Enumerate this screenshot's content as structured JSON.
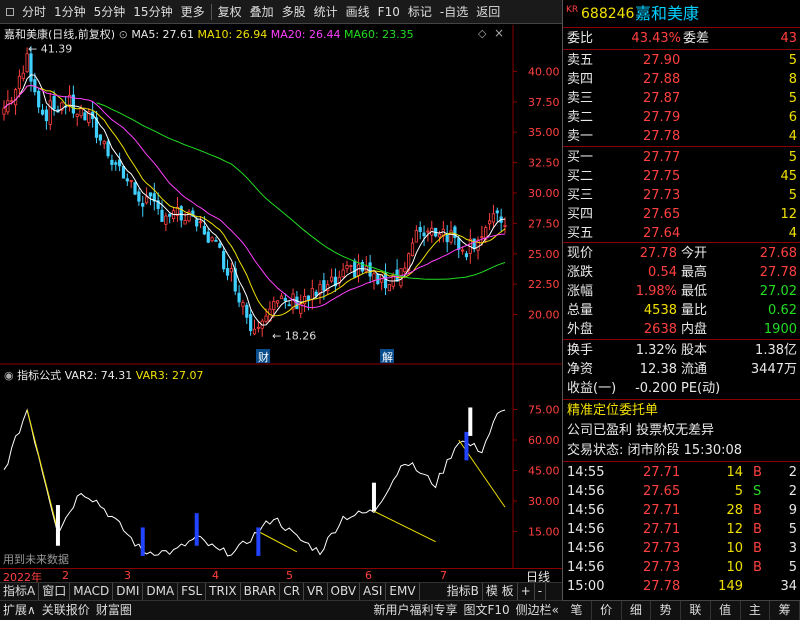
{
  "toolbar": {
    "items": [
      "分时",
      "1分钟",
      "5分钟",
      "15分钟",
      "更多",
      "复权",
      "叠加",
      "多股",
      "统计",
      "画线",
      "F10",
      "标记",
      "-自选",
      "返回"
    ]
  },
  "main_chart": {
    "title": "嘉和美康(日线,前复权)",
    "ma5": "MA5: 27.61",
    "ma10": "MA10: 26.94",
    "ma20": "MA20: 26.44",
    "ma60": "MA60: 23.35",
    "high_label": "41.39",
    "low_label": "18.26",
    "marker_cai": "财",
    "marker_jie": "解",
    "yticks": [
      40.0,
      37.5,
      35.0,
      32.5,
      30.0,
      27.5,
      25.0,
      22.5,
      20.0
    ],
    "ytick_labels": [
      "40.00",
      "37.50",
      "35.00",
      "32.50",
      "30.00",
      "27.50",
      "25.00",
      "22.50",
      "20.00"
    ],
    "colors": {
      "ma5": "#ffffff",
      "ma10": "#f0e000",
      "ma20": "#ff40ff",
      "ma60": "#22dd22",
      "up": "#ff4040",
      "down": "#40d0ff"
    }
  },
  "indicator": {
    "name": "指标公式",
    "var2": "VAR2: 74.31",
    "var3": "VAR3: 27.07",
    "note": "用到未来数据",
    "yticks": [
      75,
      60,
      45,
      30,
      15
    ],
    "ytick_labels": [
      "75.00",
      "60.00",
      "45.00",
      "30.00",
      "15.00"
    ]
  },
  "timeline": {
    "year": "2022年",
    "months": [
      "2",
      "3",
      "4",
      "5",
      "6",
      "7"
    ],
    "right_label": "日线"
  },
  "bottom_tabs": [
    "指标A",
    "窗口",
    "MACD",
    "DMI",
    "DMA",
    "FSL",
    "TRIX",
    "BRAR",
    "CR",
    "VR",
    "OBV",
    "ASI",
    "EMV",
    "指标B",
    "模 板",
    "+",
    "-"
  ],
  "status_left": [
    "扩展∧",
    "关联报价",
    "财富圈"
  ],
  "status_right": [
    "新用户福利专享",
    "图文F10",
    "侧边栏«"
  ],
  "quote": {
    "market": "KR",
    "code": "688246",
    "name": "嘉和美康",
    "webi_label": "委比",
    "webi_value": "43.43%",
    "wecha_label": "委差",
    "wecha_value": "43",
    "asks": [
      {
        "label": "卖五",
        "price": "27.90",
        "vol": "5"
      },
      {
        "label": "卖四",
        "price": "27.88",
        "vol": "8"
      },
      {
        "label": "卖三",
        "price": "27.87",
        "vol": "5"
      },
      {
        "label": "卖二",
        "price": "27.79",
        "vol": "6"
      },
      {
        "label": "卖一",
        "price": "27.78",
        "vol": "4"
      }
    ],
    "bids": [
      {
        "label": "买一",
        "price": "27.77",
        "vol": "5"
      },
      {
        "label": "买二",
        "price": "27.75",
        "vol": "45"
      },
      {
        "label": "买三",
        "price": "27.73",
        "vol": "5"
      },
      {
        "label": "买四",
        "price": "27.65",
        "vol": "12"
      },
      {
        "label": "买五",
        "price": "27.64",
        "vol": "4"
      }
    ],
    "stats": [
      {
        "l1": "现价",
        "v1": "27.78",
        "c1": "red",
        "l2": "今开",
        "v2": "27.68",
        "c2": "red"
      },
      {
        "l1": "涨跌",
        "v1": "0.54",
        "c1": "red",
        "l2": "最高",
        "v2": "27.78",
        "c2": "red"
      },
      {
        "l1": "涨幅",
        "v1": "1.98%",
        "c1": "red",
        "l2": "最低",
        "v2": "27.02",
        "c2": "green"
      },
      {
        "l1": "总量",
        "v1": "4538",
        "c1": "yellow",
        "l2": "量比",
        "v2": "0.62",
        "c2": "green"
      },
      {
        "l1": "外盘",
        "v1": "2638",
        "c1": "red",
        "l2": "内盘",
        "v2": "1900",
        "c2": "green"
      }
    ],
    "fin": [
      {
        "l1": "换手",
        "v1": "1.32%",
        "l2": "股本",
        "v2": "1.38亿"
      },
      {
        "l1": "净资",
        "v1": "12.38",
        "l2": "流通",
        "v2": "3447万"
      },
      {
        "l1": "收益(一)",
        "v1": "-0.200",
        "l2": "PE(动)",
        "v2": ""
      }
    ],
    "promo": "精准定位委托单",
    "info": "公司已盈利 投票权无差异",
    "trade_status": "交易状态: 闭市阶段 15:30:08",
    "ticks": [
      {
        "time": "14:55",
        "price": "27.71",
        "vol": "14",
        "side": "B",
        "n": "2"
      },
      {
        "time": "14:56",
        "price": "27.65",
        "vol": "5",
        "side": "S",
        "n": "2"
      },
      {
        "time": "14:56",
        "price": "27.71",
        "vol": "28",
        "side": "B",
        "n": "9"
      },
      {
        "time": "14:56",
        "price": "27.71",
        "vol": "12",
        "side": "B",
        "n": "5"
      },
      {
        "time": "14:56",
        "price": "27.73",
        "vol": "10",
        "side": "B",
        "n": "3"
      },
      {
        "time": "14:56",
        "price": "27.73",
        "vol": "10",
        "side": "B",
        "n": "5"
      },
      {
        "time": "15:00",
        "price": "27.78",
        "vol": "149",
        "side": "",
        "n": "34"
      }
    ],
    "bottom_tabs": [
      "笔",
      "价",
      "细",
      "势",
      "联",
      "值",
      "主",
      "筹"
    ]
  }
}
